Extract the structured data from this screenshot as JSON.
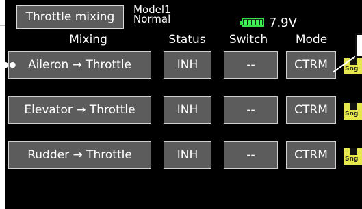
{
  "header": {
    "title": "Throttle mixing",
    "model_name": "Model1",
    "condition": "Normal",
    "voltage": "7.9V",
    "battery_icon": "battery-full-icon"
  },
  "columns": {
    "mixing": "Mixing",
    "status": "Status",
    "switch": "Switch",
    "mode": "Mode"
  },
  "rows": [
    {
      "mixing": "Aileron → Throttle",
      "status": "INH",
      "switch": "--",
      "mode": "CTRM",
      "flag": "Sng"
    },
    {
      "mixing": "Elevator → Throttle",
      "status": "INH",
      "switch": "--",
      "mode": "CTRM",
      "flag": "Sng"
    },
    {
      "mixing": "Rudder → Throttle",
      "status": "INH",
      "switch": "--",
      "mode": "CTRM",
      "flag": "Sng"
    }
  ],
  "annotations": {
    "dots": "●●"
  },
  "colors": {
    "background": "#000000",
    "button": "#5c5c5c",
    "flag": "#e6e64d",
    "battery": "#42f05a"
  }
}
